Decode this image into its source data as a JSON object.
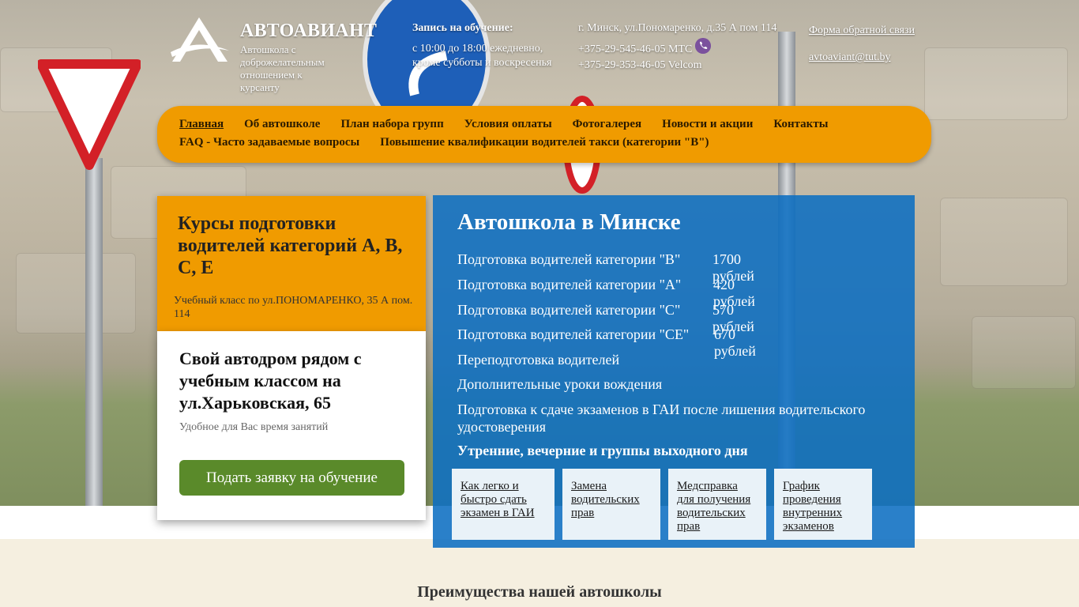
{
  "header": {
    "brand_title": "АВТОАВИАНТ",
    "brand_tagline": "Автошкола с доброжелательным отношением к курсанту",
    "schedule_title": "Запись на обучение:",
    "schedule_text": "с 10:00 до 18:00 ежедневно, кроме субботы и воскресенья",
    "address": "г. Минск, ул.Пономаренко, д.35 А пом 114",
    "phone_mts": "+375-29-545-46-05 МТС",
    "phone_velcom": "+375-29-353-46-05 Velcom",
    "feedback_link": "Форма обратной связи",
    "email_link": "avtoaviant@tut.by"
  },
  "nav": {
    "row1": [
      "Главная",
      "Об автошколе",
      "План набора групп",
      "Условия оплаты",
      "Фотогалерея",
      "Новости и акции",
      "Контакты"
    ],
    "row2": [
      "FAQ - Часто задаваемые вопросы",
      "Повышение квалификации водителей такси (категории \"В\")"
    ],
    "active": "Главная"
  },
  "left_cards": {
    "courses_title": "Курсы подготовки водителей категорий А, В, С, Е",
    "classroom_text": "Учебный класс по ул.ПОНОМАРЕНКО, 35 А пом. 114",
    "autodrome_title": "Свой автодром рядом с учебным классом на ул.Харьковская, 65",
    "autodrome_sub": "Удобное для Вас время занятий",
    "apply_button": "Подать заявку на обучение"
  },
  "main_panel": {
    "title": "Автошкола в Минске",
    "courses": [
      {
        "name": "Подготовка водителей категории \"В\"",
        "price": "1700 рублей"
      },
      {
        "name": "Подготовка водителей категории \"А\"",
        "price": "420 рублей"
      },
      {
        "name": "Подготовка водителей категории \"С\"",
        "price": "570 рублей"
      },
      {
        "name": "Подготовка водителей категории \"СЕ\"",
        "price": "670 рублей"
      }
    ],
    "extras": [
      "Переподготовка водителей",
      "Дополнительные уроки вождения",
      "Подготовка к сдаче экзаменов в ГАИ после лишения водительского удостоверения"
    ],
    "groups_text": "Утренние, вечерние и группы выходного дня",
    "tiles": [
      "Как легко и быстро сдать экзамен в ГАИ",
      "Замена водительских прав",
      "Медсправка для получения водительских прав",
      "График проведения внутренних экзаменов"
    ]
  },
  "advantages_title": "Преимущества нашей автошколы",
  "colors": {
    "accent_orange": "#f09b00",
    "panel_blue": "#0d6ec2",
    "button_green": "#5a8a2a"
  }
}
